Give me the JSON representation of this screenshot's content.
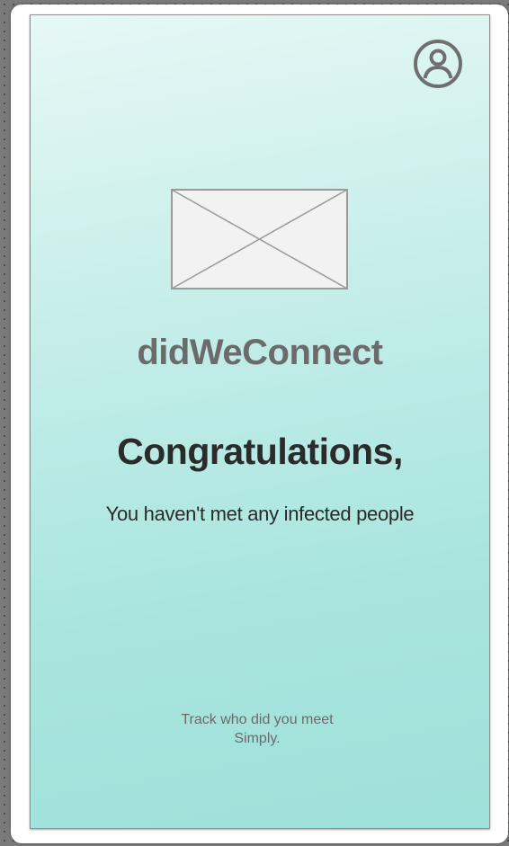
{
  "app": {
    "name": "didWeConnect"
  },
  "header": {
    "profile_icon": "user-circle-icon"
  },
  "hero": {
    "image_icon": "image-placeholder-icon"
  },
  "status": {
    "heading": "Congratulations,",
    "message": "You haven't met any infected people"
  },
  "footer": {
    "tagline_line1": "Track who did you meet",
    "tagline_line2": "Simply."
  },
  "colors": {
    "screen_top": "#e6f8f6",
    "screen_bottom": "#9ee1da",
    "app_name": "#6b6b6b",
    "heading": "#2b2b2b"
  }
}
